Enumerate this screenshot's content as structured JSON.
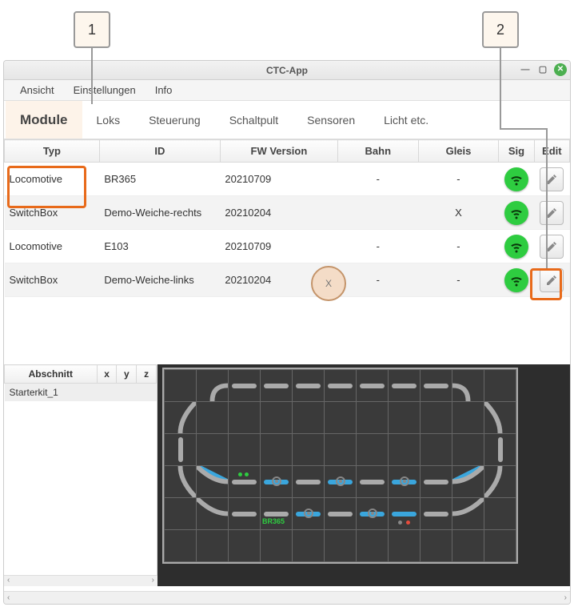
{
  "callouts": {
    "c1": "1",
    "c2": "2",
    "badge_x": "X"
  },
  "window": {
    "title": "CTC-App"
  },
  "menubar": [
    "Ansicht",
    "Einstellungen",
    "Info"
  ],
  "tabs": [
    "Module",
    "Loks",
    "Steuerung",
    "Schaltpult",
    "Sensoren",
    "Licht etc."
  ],
  "active_tab": "Module",
  "modules_table": {
    "headers": [
      "Typ",
      "ID",
      "FW Version",
      "Bahn",
      "Gleis",
      "Sig",
      "Edit"
    ],
    "rows": [
      {
        "typ": "Locomotive",
        "id": "BR365",
        "fw": "20210709",
        "bahn": "-",
        "gleis": "-",
        "sig": true
      },
      {
        "typ": "SwitchBox",
        "id": "Demo-Weiche-rechts",
        "fw": "20210204",
        "bahn": "",
        "gleis": "X",
        "sig": true
      },
      {
        "typ": "Locomotive",
        "id": "E103",
        "fw": "20210709",
        "bahn": "-",
        "gleis": "-",
        "sig": true
      },
      {
        "typ": "SwitchBox",
        "id": "Demo-Weiche-links",
        "fw": "20210204",
        "bahn": "-",
        "gleis": "-",
        "sig": true
      }
    ]
  },
  "sections_table": {
    "headers": [
      "Abschnitt",
      "x",
      "y",
      "z"
    ],
    "rows": [
      {
        "name": "Starterkit_1",
        "x": "",
        "y": "",
        "z": ""
      }
    ]
  },
  "track_label": "BR365"
}
